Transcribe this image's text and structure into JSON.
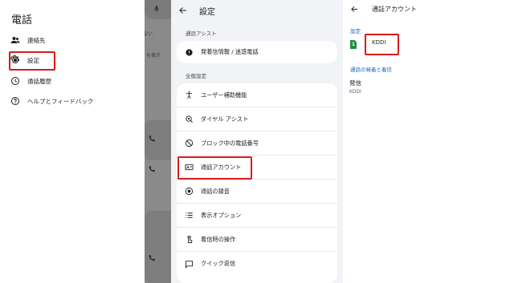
{
  "drawer": {
    "title": "電話",
    "items": [
      {
        "label": "連絡先",
        "icon": "contacts-icon"
      },
      {
        "label": "設定",
        "icon": "gear-icon"
      },
      {
        "label": "通話履歴",
        "icon": "history-icon"
      },
      {
        "label": "ヘルプとフィードバック",
        "icon": "help-icon"
      }
    ],
    "behind_text": [
      "ない",
      "を表示"
    ]
  },
  "settings": {
    "title": "設定",
    "section_assist": "通話アシスト",
    "assist_items": [
      {
        "label": "発着信情報 / 迷惑電話",
        "icon": "spam-check-icon"
      }
    ],
    "section_general": "全般設定",
    "general_items": [
      {
        "label": "ユーザー補助機能",
        "icon": "accessibility-icon"
      },
      {
        "label": "ダイヤル アシスト",
        "icon": "dial-assist-icon"
      },
      {
        "label": "ブロック中の電話番号",
        "icon": "block-icon"
      },
      {
        "label": "通話アカウント",
        "icon": "account-card-icon"
      },
      {
        "label": "通話の録音",
        "icon": "record-icon"
      },
      {
        "label": "表示オプション",
        "icon": "list-icon"
      },
      {
        "label": "着信時の操作",
        "icon": "gesture-icon"
      },
      {
        "label": "クイック返信",
        "icon": "quick-reply-icon"
      }
    ]
  },
  "calling_account": {
    "title": "通話アカウント",
    "settings_label": "設定",
    "sim_number": "1",
    "sim_name": "KDDI",
    "section_label": "通話の発着と着信",
    "outgoing_title": "発信",
    "outgoing_value": "KDDI"
  },
  "colors": {
    "highlight": "#d81b1b",
    "accent_blue": "#1a62c5",
    "sim_green": "#1e8e3e",
    "panel_bg": "#f1f3f6"
  }
}
